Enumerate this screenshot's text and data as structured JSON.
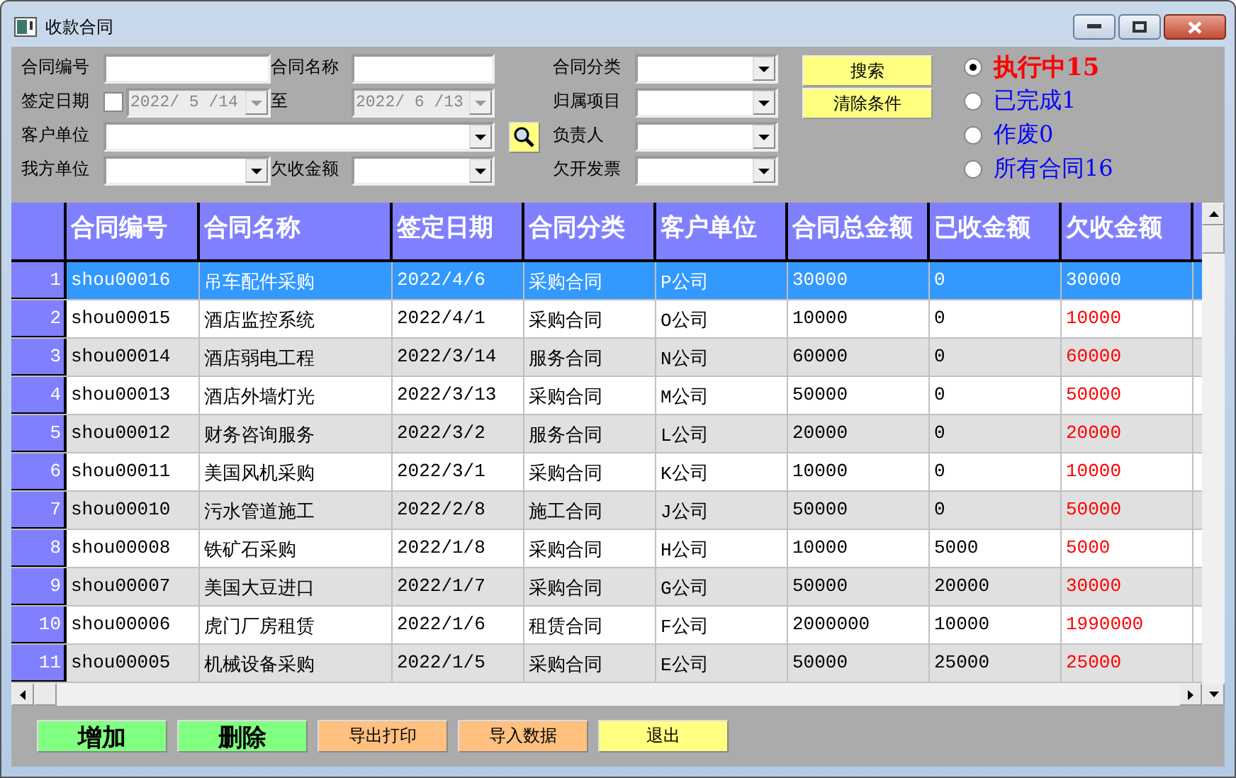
{
  "window": {
    "title": "收款合同"
  },
  "filters": [
    {
      "label": "合同编号",
      "kind": "text"
    },
    {
      "label": "合同名称",
      "kind": "text"
    },
    {
      "label": "合同分类",
      "kind": "combo"
    },
    {
      "label": "签定日期",
      "kind": "daterange",
      "checked": false,
      "from": "2022/ 5 /14",
      "to_label": "至",
      "to": "2022/ 6 /13",
      "disabled": true
    },
    {
      "label": "归属项目",
      "kind": "combo"
    },
    {
      "label": "客户单位",
      "kind": "widecombo"
    },
    {
      "label": "负责人",
      "kind": "combo"
    },
    {
      "label": "我方单位",
      "kind": "combo"
    },
    {
      "label": "欠收金额",
      "kind": "combo"
    },
    {
      "label": "欠开发票",
      "kind": "combo"
    }
  ],
  "actions": [
    "搜索",
    "清除条件"
  ],
  "statuses": [
    {
      "label": "执行中15",
      "selected": true,
      "color": "#ff0000"
    },
    {
      "label": "已完成1",
      "selected": false,
      "color": "#0000ff"
    },
    {
      "label": "作废0",
      "selected": false,
      "color": "#0000ff"
    },
    {
      "label": "所有合同16",
      "selected": false,
      "color": "#0000ff"
    }
  ],
  "table": {
    "columns": [
      "合同编号",
      "合同名称",
      "签定日期",
      "合同分类",
      "客户单位",
      "合同总金额",
      "已收金额",
      "欠收金额"
    ],
    "rows": [
      {
        "no": "1",
        "cells": [
          "shou00016",
          "吊车配件采购",
          "2022/4/6",
          "采购合同",
          "P公司",
          "30000",
          "0",
          "30000"
        ],
        "selected": true
      },
      {
        "no": "2",
        "cells": [
          "shou00015",
          "酒店监控系统",
          "2022/4/1",
          "采购合同",
          "O公司",
          "10000",
          "0",
          "10000"
        ],
        "selected": false
      },
      {
        "no": "3",
        "cells": [
          "shou00014",
          "酒店弱电工程",
          "2022/3/14",
          "服务合同",
          "N公司",
          "60000",
          "0",
          "60000"
        ],
        "selected": false
      },
      {
        "no": "4",
        "cells": [
          "shou00013",
          "酒店外墙灯光",
          "2022/3/13",
          "采购合同",
          "M公司",
          "50000",
          "0",
          "50000"
        ],
        "selected": false
      },
      {
        "no": "5",
        "cells": [
          "shou00012",
          "财务咨询服务",
          "2022/3/2",
          "服务合同",
          "L公司",
          "20000",
          "0",
          "20000"
        ],
        "selected": false
      },
      {
        "no": "6",
        "cells": [
          "shou00011",
          "美国风机采购",
          "2022/3/1",
          "采购合同",
          "K公司",
          "10000",
          "0",
          "10000"
        ],
        "selected": false
      },
      {
        "no": "7",
        "cells": [
          "shou00010",
          "污水管道施工",
          "2022/2/8",
          "施工合同",
          "J公司",
          "50000",
          "0",
          "50000"
        ],
        "selected": false
      },
      {
        "no": "8",
        "cells": [
          "shou00008",
          "铁矿石采购",
          "2022/1/8",
          "采购合同",
          "H公司",
          "10000",
          "5000",
          "5000"
        ],
        "selected": false
      },
      {
        "no": "9",
        "cells": [
          "shou00007",
          "美国大豆进口",
          "2022/1/7",
          "采购合同",
          "G公司",
          "50000",
          "20000",
          "30000"
        ],
        "selected": false
      },
      {
        "no": "10",
        "cells": [
          "shou00006",
          "虎门厂房租赁",
          "2022/1/6",
          "租赁合同",
          "F公司",
          "2000000",
          "10000",
          "1990000"
        ],
        "selected": false
      },
      {
        "no": "11",
        "cells": [
          "shou00005",
          "机械设备采购",
          "2022/1/5",
          "采购合同",
          "E公司",
          "50000",
          "25000",
          "25000"
        ],
        "selected": false
      }
    ]
  },
  "buttons": [
    {
      "label": "增加",
      "kind": "big",
      "color": "#80ff80"
    },
    {
      "label": "删除",
      "kind": "big",
      "color": "#80ff80"
    },
    {
      "label": "导出打印",
      "kind": "small",
      "color": "#ffc080"
    },
    {
      "label": "导入数据",
      "kind": "small",
      "color": "#ffc080"
    },
    {
      "label": "退出",
      "kind": "small",
      "color": "#ffff80"
    }
  ]
}
